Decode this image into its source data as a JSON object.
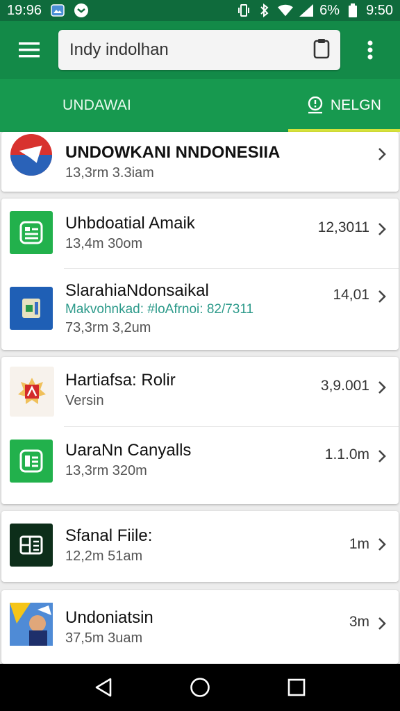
{
  "status": {
    "time_left": "19:96",
    "battery": "6%",
    "time_right": "9:50"
  },
  "search": {
    "value": "Indy indolhan"
  },
  "tabs": [
    {
      "label": "UNDAWAI"
    },
    {
      "label": "NELGN"
    }
  ],
  "items": [
    {
      "title": "UNDOWKANI NNDONESIIA",
      "subtitle": "13,3rm 3.3iam",
      "size": ""
    },
    {
      "title": "Uhbdoatial Amaik",
      "subtitle": "13,4m 30om",
      "size": "12,3011"
    },
    {
      "title": "SlarahiaNdonsaikal",
      "note": "Makvohnkad: #loAfrnoi: 82/7311",
      "subtitle": "73,3rm 3,2um",
      "size": "14,01"
    },
    {
      "title": "Hartiafsa: Rolir",
      "subtitle": "Versin",
      "size": "3,9.001"
    },
    {
      "title": "UaraNn Canyalls",
      "subtitle": "13,3rm 320m",
      "size": "1.1.0m"
    },
    {
      "title": "Sfanal Fiile:",
      "subtitle": "12,2m 51am",
      "size": "1m"
    },
    {
      "title": "Undoniatsin",
      "subtitle": "37,5m 3uam",
      "size": "3m"
    }
  ],
  "icons": {
    "menu": "hamburger-menu-icon",
    "clipboard": "clipboard-icon",
    "overflow": "more-vert-icon",
    "tab_location": "location-pin-icon",
    "chevron": "chevron-right-icon"
  },
  "colors": {
    "app_bar": "#138a48",
    "tabs": "#17994f",
    "indicator": "#d7e33a",
    "status_bar": "#0f6b3c"
  }
}
